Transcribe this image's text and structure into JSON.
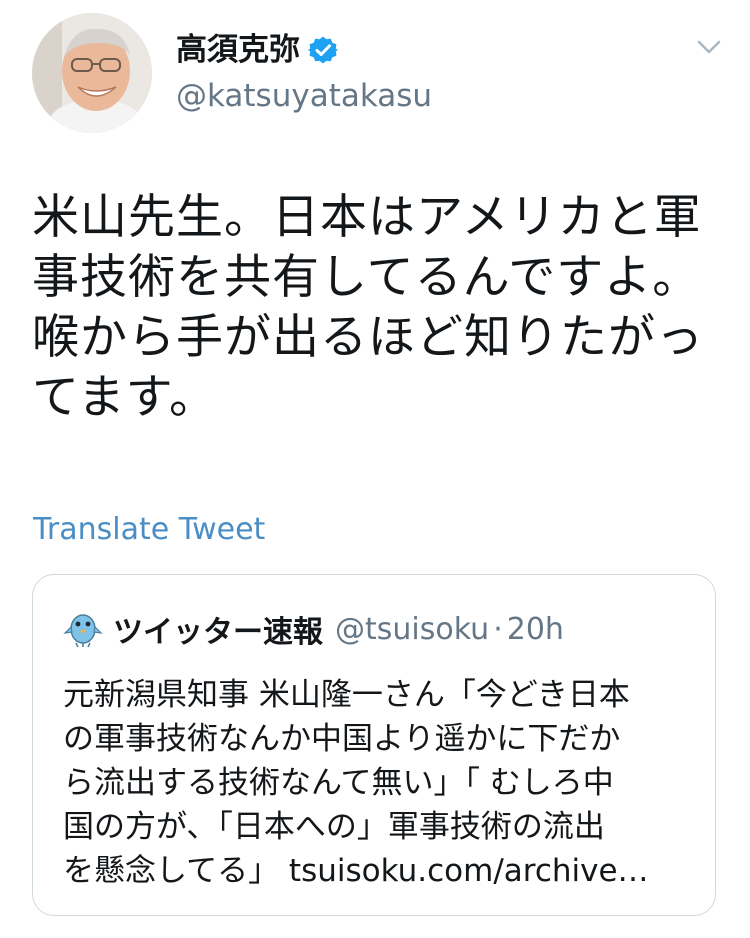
{
  "tweet": {
    "author": {
      "display_name": "高須克弥",
      "handle": "@katsuyatakasu",
      "verified": true,
      "avatar_icon": "avatar-photo"
    },
    "menu_icon": "chevron-down-icon",
    "text": "米山先生。日本はアメリカと軍\n事技術を共有してるんですよ。\n喉から手が出るほど知りたがっ\nてます。",
    "translate_label": "Translate Tweet"
  },
  "quoted_tweet": {
    "avatar_icon": "bird-icon",
    "display_name": "ツイッター速報",
    "handle": "@tsuisoku",
    "separator": "·",
    "time": "20h",
    "text": "元新潟県知事 米山隆一さん「今どき日本\nの軍事技術なんか中国より遥かに下だか\nら流出する技術なんて無い」「 むしろ中\n国の方が、「日本への」軍事技術の流出\nを懸念してる」 tsuisoku.com/archive…"
  },
  "colors": {
    "link": "#4a8ec5",
    "verified_badge": "#1da1f2",
    "secondary_text": "#657786",
    "border": "#cfd9de"
  }
}
